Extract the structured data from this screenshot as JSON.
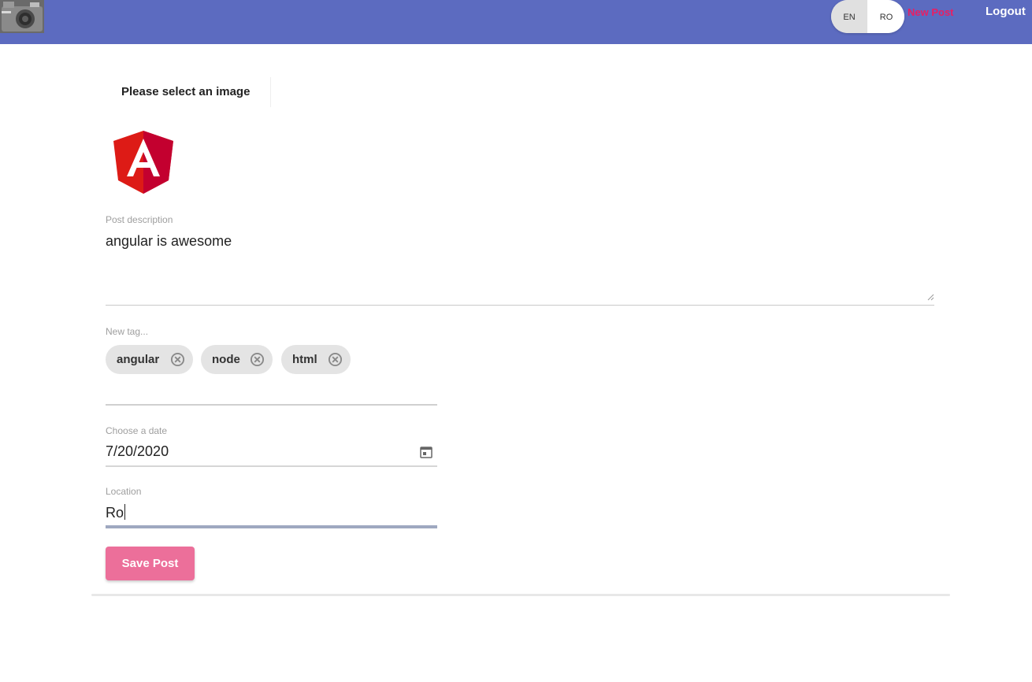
{
  "header": {
    "logo_icon": "camera-icon",
    "lang_options": [
      "EN",
      "RO"
    ],
    "lang_selected": "EN",
    "new_post_label": "New Post",
    "logout_label": "Logout",
    "bar_color": "#5c6bc0",
    "accent_color": "#e91e63"
  },
  "form": {
    "image_picker_label": "Please select an image",
    "preview_icon": "angular-logo",
    "description": {
      "label": "Post description",
      "value": "angular is awesome"
    },
    "tags": {
      "label": "New tag...",
      "chips": [
        "angular",
        "node",
        "html"
      ],
      "remove_icon": "cancel-circle-icon"
    },
    "date": {
      "label": "Choose a date",
      "value": "7/20/2020",
      "icon": "calendar-icon"
    },
    "location": {
      "label": "Location",
      "value": "Ro"
    },
    "save_label": "Save Post",
    "save_color": "#ec6f9a"
  }
}
